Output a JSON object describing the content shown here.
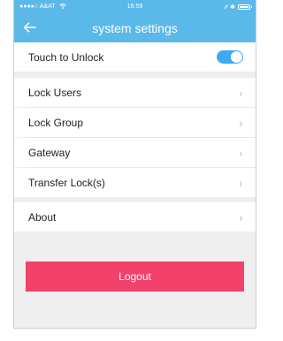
{
  "status_bar": {
    "carrier": "●●●●○ A&AT",
    "wifi_icon": "wifi-icon",
    "time": "16:59",
    "indicators": "⇗ ✱"
  },
  "nav": {
    "back_icon": "back-arrow-icon",
    "title": "system settings"
  },
  "settings": {
    "touch_unlock_label": "Touch to Unlock",
    "touch_unlock_on": true,
    "items": [
      {
        "label": "Lock Users"
      },
      {
        "label": "Lock Group"
      },
      {
        "label": "Gateway"
      },
      {
        "label": "Transfer Lock(s)"
      }
    ],
    "about_label": "About",
    "chevron": "›"
  },
  "logout": {
    "label": "Logout"
  },
  "colors": {
    "accent": "#5bb9e9",
    "toggle": "#3fa9f5",
    "logout": "#f2416b",
    "background": "#efefef"
  }
}
